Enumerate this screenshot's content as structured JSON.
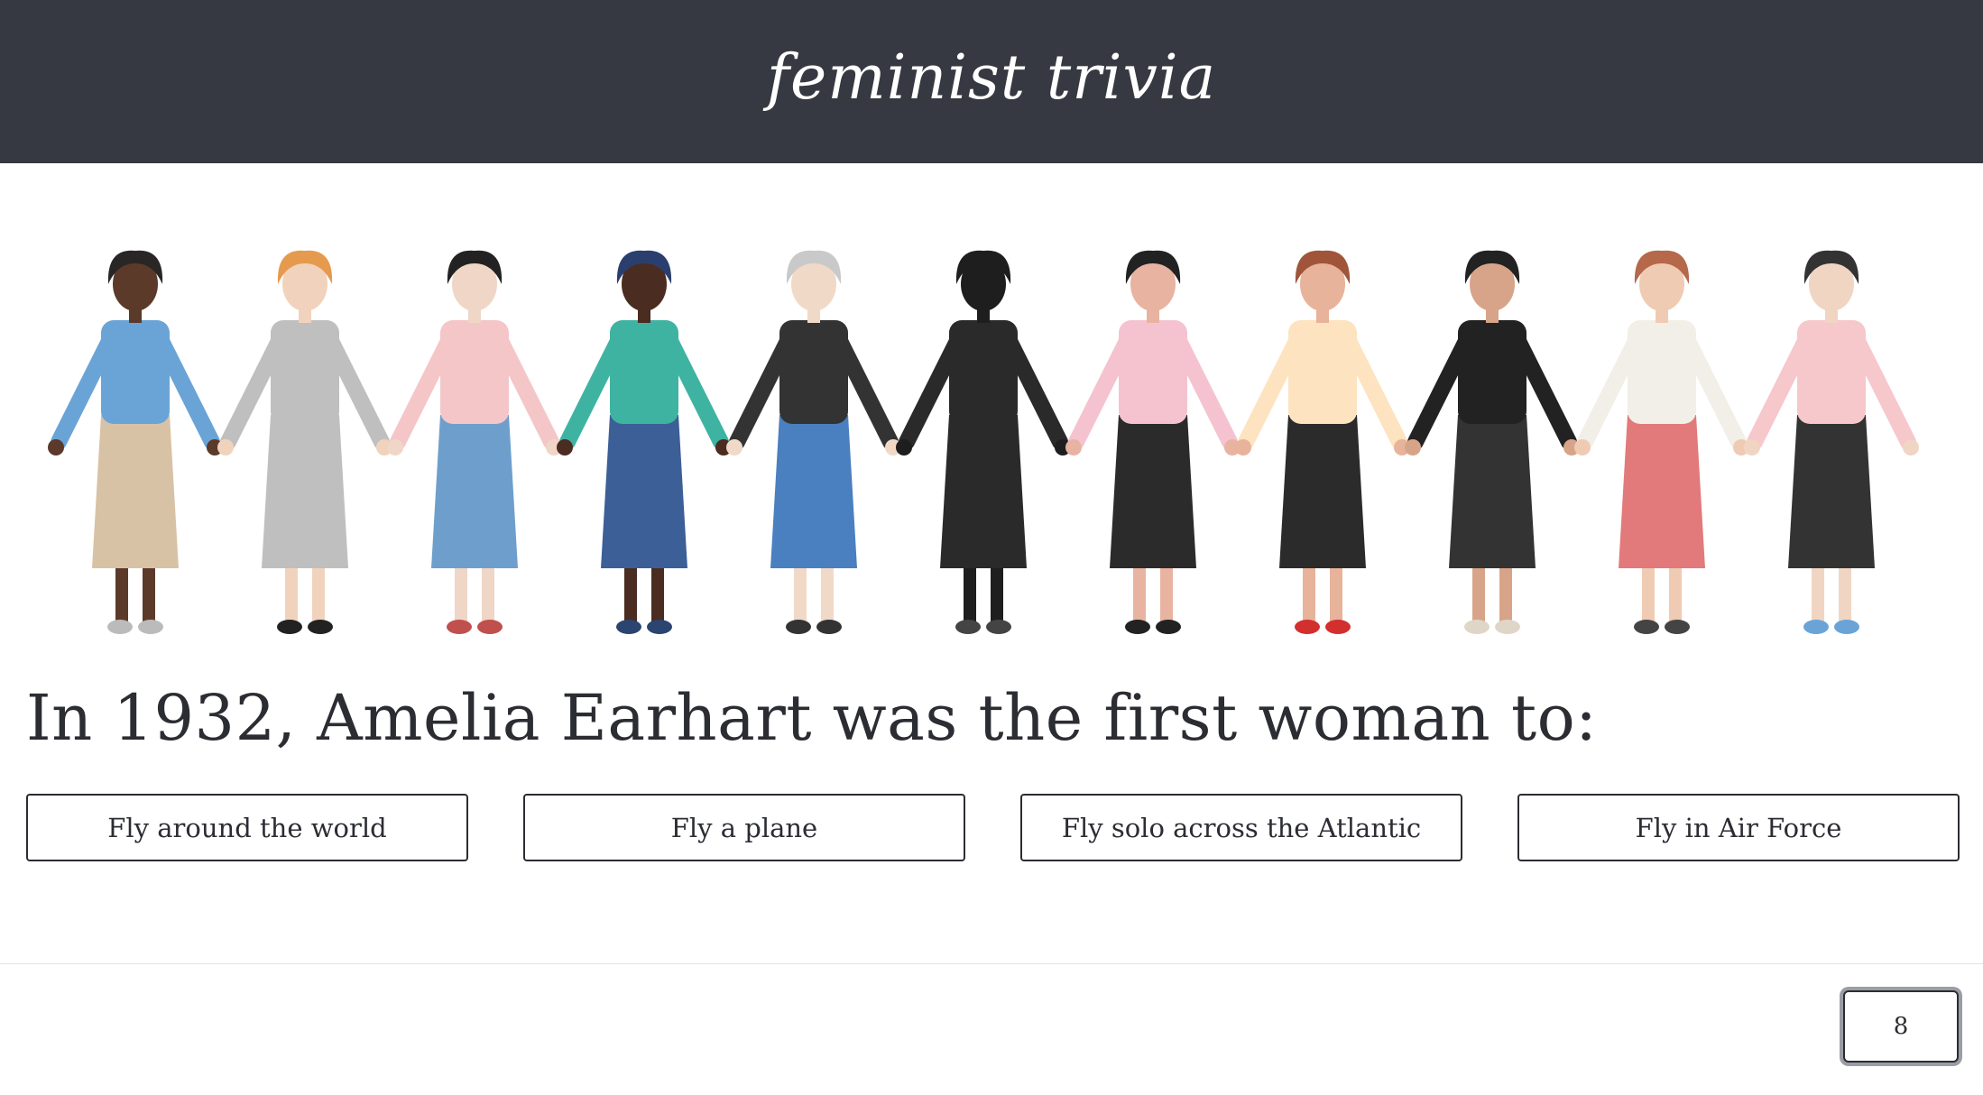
{
  "header": {
    "logo_text": "feminist trivia",
    "background": "#363941"
  },
  "illustration": {
    "description_icon": "women-holding-hands-illustration",
    "figures": [
      {
        "hair": "#2b2626",
        "skin": "#5b3a2a",
        "top": "#6aa4d6",
        "bottom": "#d8c2a5",
        "shoes": "#bbbbbb"
      },
      {
        "hair": "#e69a4e",
        "skin": "#f1d3bd",
        "top": "#bfbfbf",
        "bottom": "#bfbfbf",
        "shoes": "#222222"
      },
      {
        "hair": "#222222",
        "skin": "#f0d6c6",
        "top": "#f4c6c8",
        "bottom": "#6e9fcc",
        "shoes": "#c0504d"
      },
      {
        "hair": "#2b3f6e",
        "skin": "#4a2c20",
        "top": "#3fb3a2",
        "bottom": "#3b5f96",
        "shoes": "#2b4470"
      },
      {
        "hair": "#c9c9c9",
        "skin": "#f1d9c8",
        "top": "#333333",
        "bottom": "#4a7fc0",
        "shoes": "#333333"
      },
      {
        "hair": "#1e1e1e",
        "skin": "#1e1e1e",
        "top": "#2a2a2a",
        "bottom": "#2a2a2a",
        "shoes": "#444444"
      },
      {
        "hair": "#222222",
        "skin": "#e8b3a0",
        "top": "#f5c3d0",
        "bottom": "#2b2b2b",
        "shoes": "#222222"
      },
      {
        "hair": "#a0553a",
        "skin": "#e7b39a",
        "top": "#fde3bf",
        "bottom": "#2b2b2b",
        "shoes": "#d32f2f"
      },
      {
        "hair": "#222222",
        "skin": "#d8a489",
        "top": "#222222",
        "bottom": "#333333",
        "shoes": "#e0d6c8"
      },
      {
        "hair": "#b5684a",
        "skin": "#f0cbb3",
        "top": "#f2efe8",
        "bottom": "#e2797a",
        "shoes": "#444444"
      },
      {
        "hair": "#333333",
        "skin": "#f1d5c3",
        "top": "#f6c7cb",
        "bottom": "#333333",
        "shoes": "#6aa4d6"
      }
    ]
  },
  "question": {
    "text": "In 1932, Amelia Earhart was the first woman to:"
  },
  "answers": [
    {
      "label": "Fly around the world"
    },
    {
      "label": "Fly a plane"
    },
    {
      "label": "Fly solo across the Atlantic"
    },
    {
      "label": "Fly in Air Force"
    }
  ],
  "counter": {
    "value": "8"
  }
}
